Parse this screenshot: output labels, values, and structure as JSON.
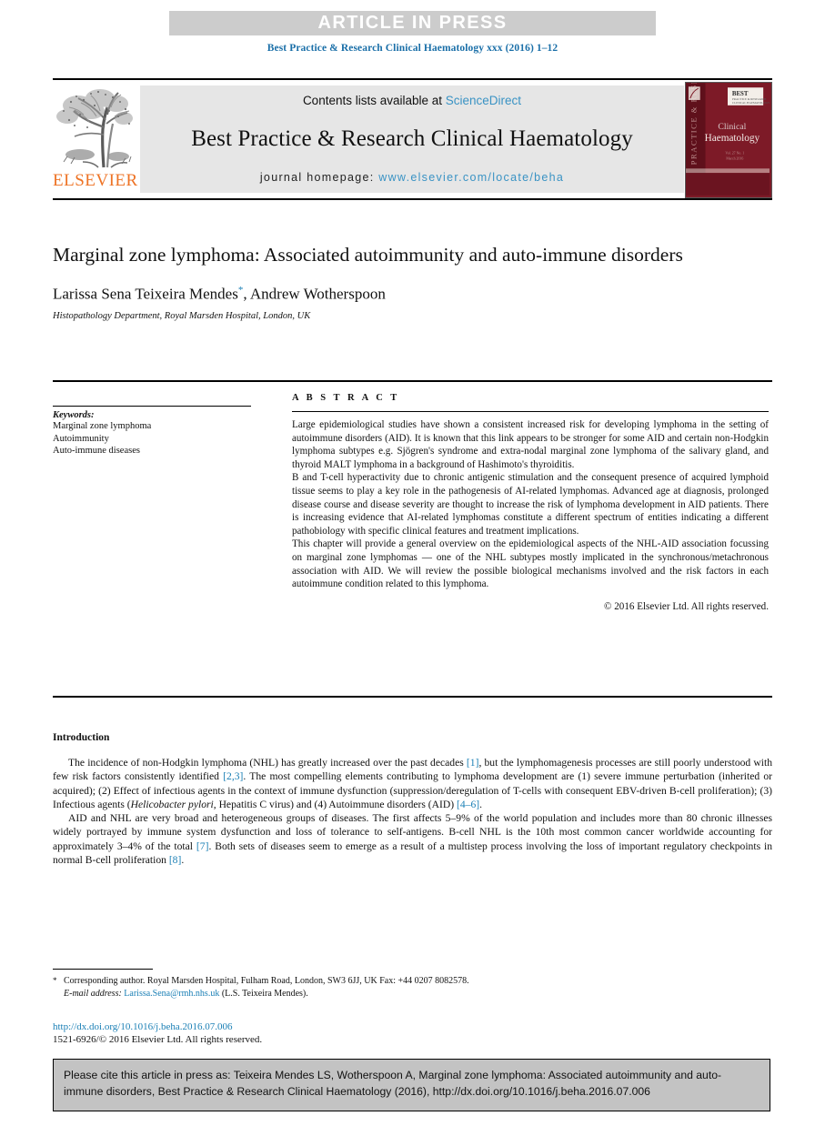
{
  "banner": {
    "label": "ARTICLE IN PRESS"
  },
  "running_head": "Best Practice & Research Clinical Haematology xxx (2016) 1–12",
  "masthead": {
    "publisher_name": "ELSEVIER",
    "publisher_logo_alt": "elsevier-tree-icon",
    "contents_prefix": "Contents lists available at ",
    "contents_link": "ScienceDirect",
    "journal_name": "Best Practice & Research Clinical Haematology",
    "homepage_prefix": "journal homepage: ",
    "homepage_url": "www.elsevier.com/locate/beha",
    "cover": {
      "vertical_text": "PRACTICE & RESEARCH",
      "badge_line1": "BEST",
      "badge_line2": "PRACTICE & RESEARCH",
      "badge_line3": "CLINICAL HAEMATOLOGY",
      "title_line1": "Clinical",
      "title_line2": "Haematology",
      "sub_line1": "Vol. 27  No. 1",
      "sub_line2": "March 2016",
      "bg_color": "#7d1a27",
      "accent_color": "#5a1019"
    },
    "link_color": "#3a93c4",
    "brand_color": "#ee7325"
  },
  "article": {
    "title": "Marginal zone lymphoma: Associated autoimmunity and auto-immune disorders",
    "authors": "Larissa Sena Teixeira Mendes",
    "corresponding_mark": "*",
    "authors_rest": ", Andrew Wotherspoon",
    "affiliation": "Histopathology Department, Royal Marsden Hospital, London, UK"
  },
  "keywords": {
    "heading": "Keywords:",
    "items": [
      "Marginal zone lymphoma",
      "Autoimmunity",
      "Auto-immune diseases"
    ]
  },
  "abstract": {
    "heading": "A B S T R A C T",
    "paragraphs": [
      "Large epidemiological studies have shown a consistent increased risk for developing lymphoma in the setting of autoimmune disorders (AID). It is known that this link appears to be stronger for some AID and certain non-Hodgkin lymphoma subtypes e.g. Sjögren's syndrome and extra-nodal marginal zone lymphoma of the salivary gland, and thyroid MALT lymphoma in a background of Hashimoto's thyroiditis.",
      "B and T-cell hyperactivity due to chronic antigenic stimulation and the consequent presence of acquired lymphoid tissue seems to play a key role in the pathogenesis of AI-related lymphomas. Advanced age at diagnosis, prolonged disease course and disease severity are thought to increase the risk of lymphoma development in AID patients. There is increasing evidence that AI-related lymphomas constitute a different spectrum of entities indicating a different pathobiology with specific clinical features and treatment implications.",
      "This chapter will provide a general overview on the epidemiological aspects of the NHL-AID association focussing on marginal zone lymphomas — one of the NHL subtypes mostly implicated in the synchronous/metachronous association with AID. We will review the possible biological mechanisms involved and the risk factors in each autoimmune condition related to this lymphoma."
    ],
    "copyright": "© 2016 Elsevier Ltd. All rights reserved."
  },
  "introduction": {
    "heading": "Introduction",
    "paragraph1": {
      "seg1": "The incidence of non-Hodgkin lymphoma (NHL) has greatly increased over the past decades ",
      "ref1": "[1]",
      "seg2": ", but the lymphomagenesis processes are still poorly understood with few risk factors consistently identified ",
      "ref2": "[2,3]",
      "seg3": ". The most compelling elements contributing to lymphoma development are (1) severe immune perturbation (inherited or acquired); (2) Effect of infectious agents in the context of immune dysfunction (suppression/deregulation of T-cells with consequent EBV-driven B-cell proliferation); (3) Infectious agents (",
      "italic1": "Helicobacter pylori",
      "seg4": ", Hepatitis C virus) and (4) Autoimmune disorders (AID) ",
      "ref3": "[4–6]",
      "seg5": "."
    },
    "paragraph2": {
      "seg1": "AID and NHL are very broad and heterogeneous groups of diseases. The first affects 5–9% of the world population and includes more than 80 chronic illnesses widely portrayed by immune system dysfunction and loss of tolerance to self-antigens. B-cell NHL is the 10th most common cancer worldwide accounting for approximately 3–4% of the total ",
      "ref1": "[7]",
      "seg2": ". Both sets of diseases seem to emerge as a result of a multistep process involving the loss of important regulatory checkpoints in normal B-cell proliferation ",
      "ref2": "[8]",
      "seg3": "."
    }
  },
  "footnotes": {
    "corresponding": "Corresponding author. Royal Marsden Hospital, Fulham Road, London, SW3 6JJ, UK Fax: +44 0207 8082578.",
    "email_label": "E-mail address:",
    "email": "Larissa.Sena@rmh.nhs.uk",
    "email_owner": "(L.S. Teixeira Mendes).",
    "doi": "http://dx.doi.org/10.1016/j.beha.2016.07.006",
    "issn_copyright": "1521-6926/© 2016 Elsevier Ltd. All rights reserved."
  },
  "citation_box": {
    "text": "Please cite this article in press as: Teixeira Mendes LS, Wotherspoon A, Marginal zone lymphoma: Associated autoimmunity and auto-immune disorders, Best Practice & Research Clinical Haematology (2016), http://dx.doi.org/10.1016/j.beha.2016.07.006"
  }
}
